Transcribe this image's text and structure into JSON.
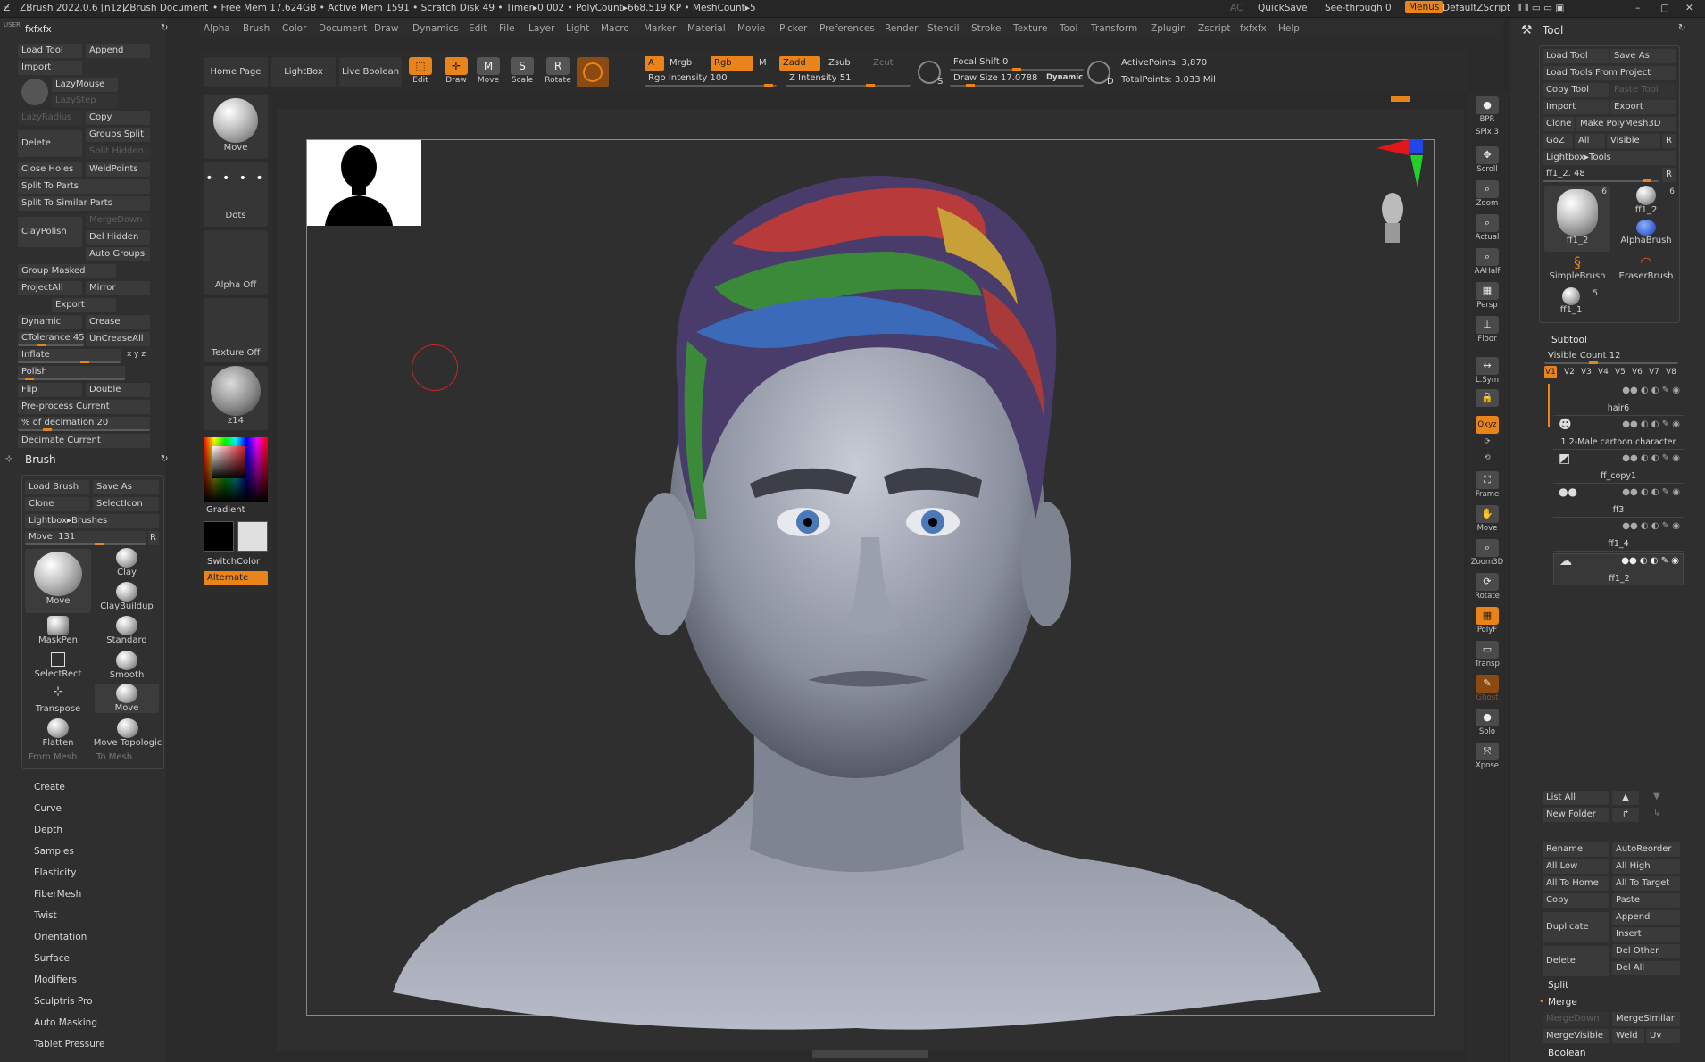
{
  "titlebar": {
    "app": "ZBrush 2022.0.6 [n1z]",
    "doc": "ZBrush Document",
    "stats": "• Free Mem 17.624GB • Active Mem 1591 • Scratch Disk 49 • Timer▸0.002 • PolyCount▸668.519 KP • MeshCount▸5",
    "ac": "AC",
    "quicksave": "QuickSave",
    "seethrough": "See-through  0",
    "menus": "Menus",
    "script": "DefaultZScript"
  },
  "menubar": [
    "Alpha",
    "Brush",
    "Color",
    "Document",
    "Draw",
    "Dynamics",
    "Edit",
    "File",
    "Layer",
    "Light",
    "Macro",
    "Marker",
    "Material",
    "Movie",
    "Picker",
    "Preferences",
    "Render",
    "Stencil",
    "Stroke",
    "Texture",
    "Tool",
    "Transform",
    "Zplugin",
    "Zscript",
    "fxfxfx",
    "Help"
  ],
  "userpanel": {
    "user": "USER",
    "name": "fxfxfx",
    "buttons": {
      "load_tool": "Load Tool",
      "append": "Append",
      "import": "Import",
      "lazymouse": "LazyMouse",
      "lazystep": "LazyStep",
      "lazyradius": "LazyRadius",
      "copy": "Copy",
      "delete": "Delete",
      "groups_split": "Groups Split",
      "split_hidden": "Split Hidden",
      "close_holes": "Close Holes",
      "weldpoints": "WeldPoints",
      "split_to_parts": "Split To Parts",
      "split_to_similar": "Split To Similar Parts",
      "claypolish": "ClayPolish",
      "mergedown": "MergeDown",
      "del_hidden": "Del Hidden",
      "auto_groups": "Auto Groups",
      "group_masked": "Group Masked",
      "projectall": "ProjectAll",
      "mirror": "Mirror",
      "export": "Export",
      "dynamic": "Dynamic",
      "crease": "Crease",
      "ctolerance": "CTolerance 45",
      "uncreaseall": "UnCreaseAll",
      "inflate": "Inflate",
      "xyz": "x y z",
      "polish": "Polish",
      "flip": "Flip",
      "double": "Double",
      "preprocess": "Pre-process Current",
      "decimation": "% of decimation 20",
      "decimate": "Decimate Current"
    }
  },
  "brushpanel": {
    "title": "Brush",
    "load": "Load Brush",
    "saveas": "Save As",
    "clone": "Clone",
    "selecticon": "SelectIcon",
    "lightbox": "Lightbox▸Brushes",
    "move_slider": "Move. 131",
    "r": "R",
    "brushes": [
      "Move",
      "Clay",
      "ClayBuildup",
      "MaskPen",
      "Standard",
      "SelectRect",
      "Smooth",
      "Transpose",
      "Move",
      "Flatten",
      "Move Topologic"
    ],
    "from_mesh": "From Mesh",
    "to_mesh": "To Mesh"
  },
  "leftmenu": [
    "Create",
    "Curve",
    "Depth",
    "Samples",
    "Elasticity",
    "FiberMesh",
    "Twist",
    "Orientation",
    "Surface",
    "Modifiers",
    "Sculptris Pro",
    "Auto Masking",
    "Tablet Pressure"
  ],
  "shelf": {
    "home": "Home Page",
    "lightbox": "LightBox",
    "liveboolean": "Live Boolean",
    "edit": "Edit",
    "draw": "Draw",
    "move": "Move",
    "scale": "Scale",
    "rotate": "Rotate",
    "a": "A",
    "mrgb": "Mrgb",
    "rgb": "Rgb",
    "m": "M",
    "zadd": "Zadd",
    "zsub": "Zsub",
    "zcut": "Zcut",
    "rgb_intensity": "Rgb Intensity 100",
    "z_intensity": "Z Intensity 51",
    "focal": "Focal Shift 0",
    "drawsize": "Draw Size 17.0788",
    "dynamic": "Dynamic",
    "activepoints": "ActivePoints: 3,870",
    "totalpoints": "TotalPoints: 3.033 Mil"
  },
  "palette": {
    "move": "Move",
    "dots": "Dots",
    "alphaoff": "Alpha Off",
    "textureoff": "Texture Off",
    "material": "z14",
    "gradient": "Gradient",
    "switchcolor": "SwitchColor",
    "alternate": "Alternate"
  },
  "righttools": [
    "BPR",
    "SPix 3",
    "Scroll",
    "Zoom",
    "Actual",
    "AAHalf",
    "Persp",
    "Floor",
    "L.Sym",
    "",
    "Qxyz",
    "",
    "",
    "Frame",
    "Move",
    "Zoom3D",
    "Rotate",
    "PolyF",
    "Transp",
    "Ghost",
    "Solo",
    "Xpose"
  ],
  "toolpanel": {
    "title": "Tool",
    "load_tool": "Load Tool",
    "save_as": "Save As",
    "load_from_project": "Load Tools From Project",
    "copy_tool": "Copy Tool",
    "paste_tool": "Paste Tool",
    "import": "Import",
    "export": "Export",
    "clone": "Clone",
    "make_polymesh": "Make PolyMesh3D",
    "goz": "GoZ",
    "all": "All",
    "visible": "Visible",
    "r": "R",
    "lightbox_tools": "Lightbox▸Tools",
    "ff1_slider": "ff1_2. 48",
    "thumbs": [
      {
        "name": "ff1_2",
        "count": "6"
      },
      {
        "name": "ff1_2",
        "count": "6"
      },
      {
        "name": "AlphaBrush",
        "count": ""
      },
      {
        "name": "SimpleBrush",
        "count": ""
      },
      {
        "name": "EraserBrush",
        "count": ""
      },
      {
        "name": "ff1_1",
        "count": "5"
      }
    ],
    "subtool": "Subtool",
    "visible_count": "Visible Count 12",
    "versions": [
      "V1",
      "V2",
      "V3",
      "V4",
      "V5",
      "V6",
      "V7",
      "V8"
    ],
    "subtools": [
      "hair6",
      "1.2-Male cartoon character",
      "ff_copy1",
      "ff3",
      "ff1_4",
      "ff1_2"
    ],
    "list_all": "List All",
    "new_folder": "New Folder",
    "rename": "Rename",
    "autoreorder": "AutoReorder",
    "all_low": "All Low",
    "all_high": "All High",
    "all_to_home": "All To Home",
    "all_to_target": "All To Target",
    "copy": "Copy",
    "paste": "Paste",
    "duplicate": "Duplicate",
    "append": "Append",
    "insert": "Insert",
    "delete": "Delete",
    "del_other": "Del Other",
    "del_all": "Del All",
    "split": "Split",
    "merge": "Merge",
    "mergedown": "MergeDown",
    "mergesimilar": "MergeSimilar",
    "mergevisible": "MergeVisible",
    "weld": "Weld",
    "uv": "Uv",
    "boolean": "Boolean"
  },
  "colors": {
    "accent": "#e8841a",
    "bg": "#2a2a2a",
    "panel": "#2f2f2f",
    "button": "#3a3a3a"
  }
}
